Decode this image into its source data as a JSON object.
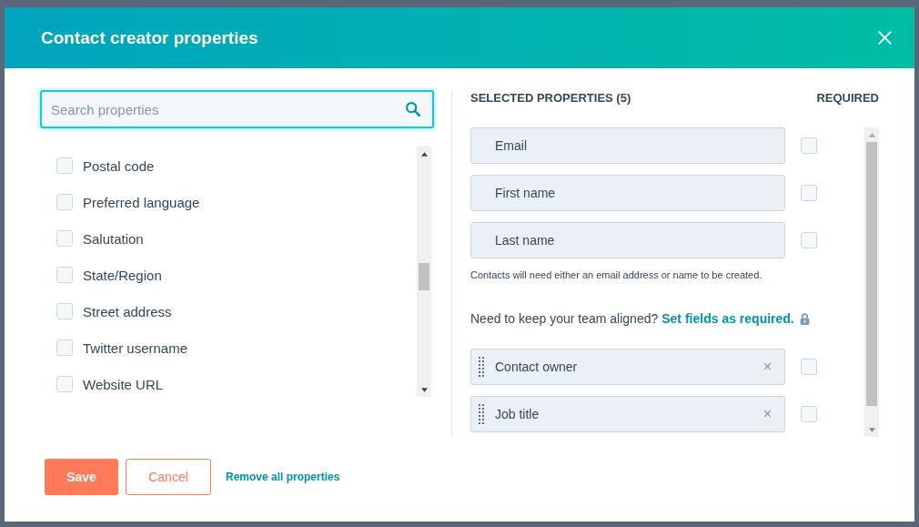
{
  "dialog": {
    "title": "Contact creator properties"
  },
  "search": {
    "placeholder": "Search properties"
  },
  "available_properties": [
    {
      "label": "Postal code",
      "checked": false
    },
    {
      "label": "Preferred language",
      "checked": false
    },
    {
      "label": "Salutation",
      "checked": false
    },
    {
      "label": "State/Region",
      "checked": false
    },
    {
      "label": "Street address",
      "checked": false
    },
    {
      "label": "Twitter username",
      "checked": false
    },
    {
      "label": "Website URL",
      "checked": false
    }
  ],
  "selected_header": "SELECTED PROPERTIES (5)",
  "required_header": "REQUIRED",
  "selected_properties": [
    {
      "kind": "fixed",
      "label": "Email",
      "required": false
    },
    {
      "kind": "fixed",
      "label": "First name",
      "required": false
    },
    {
      "kind": "fixed",
      "label": "Last name",
      "required": false
    },
    {
      "kind": "note",
      "text": "Contacts will need either an email address or name to be created."
    },
    {
      "kind": "upsell",
      "text": "Need to keep your team aligned?",
      "link": "Set fields as required."
    },
    {
      "kind": "removable",
      "label": "Contact owner",
      "remove": "×",
      "required": false
    },
    {
      "kind": "removable",
      "label": "Job title",
      "remove": "×",
      "required": false
    }
  ],
  "buttons": {
    "save": "Save",
    "cancel": "Cancel",
    "remove_all": "Remove all properties"
  }
}
